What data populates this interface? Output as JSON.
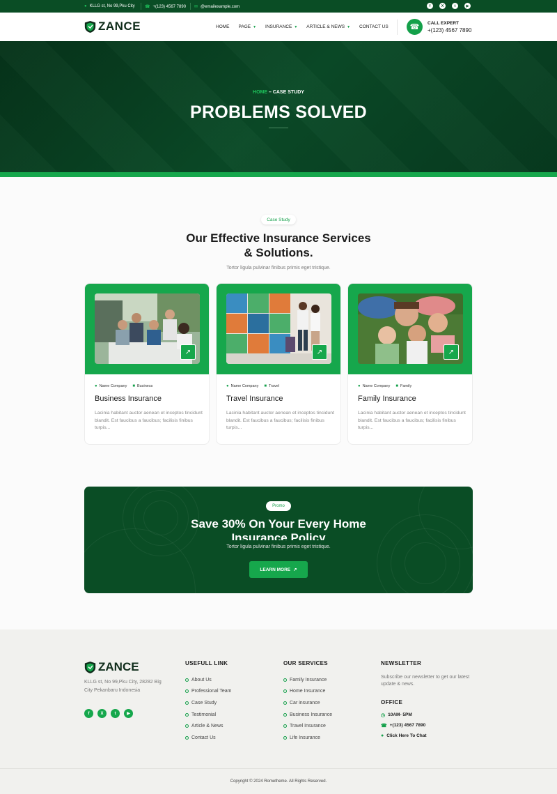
{
  "topbar": {
    "address": "KLLG st, No 99,Pku City",
    "phone": "+(123) 4567 7890",
    "email": "@emailexample.com",
    "social_icons": [
      "facebook-icon",
      "x-icon",
      "twitter-icon",
      "youtube-icon"
    ]
  },
  "nav": {
    "logo": "ZANCE",
    "items": [
      {
        "label": "HOME",
        "dropdown": false
      },
      {
        "label": "PAGE",
        "dropdown": true
      },
      {
        "label": "INSURANCE",
        "dropdown": true
      },
      {
        "label": "ARTICLE & NEWS",
        "dropdown": true
      },
      {
        "label": "CONTACT US",
        "dropdown": false
      }
    ],
    "call_label": "CALL EXPERT",
    "call_number": "+(123) 4567 7890"
  },
  "hero": {
    "crumb_home": "HOME",
    "crumb_current": "– CASE STUDY",
    "title": "PROBLEMS SOLVED"
  },
  "section": {
    "pill": "Case Study",
    "title_line1": "Our Effective Insurance Services",
    "title_line2": "& Solutions.",
    "subtitle": "Tortor ligula pulvinar finibus primis eget tristique."
  },
  "cards": [
    {
      "author": "Name Company",
      "category": "Business",
      "title": "Business Insurance",
      "text": "Lacinia habitant auctor aenean et inceptos tincidunt blandit. Est faucibus a faucibus; facilisis finibus turpis..."
    },
    {
      "author": "Name Company",
      "category": "Travel",
      "title": "Travel Insurance",
      "text": "Lacinia habitant auctor aenean et inceptos tincidunt blandit. Est faucibus a faucibus; facilisis finibus turpis..."
    },
    {
      "author": "Name Company",
      "category": "Family",
      "title": "Family Insurance",
      "text": "Lacinia habitant auctor aenean et inceptos tincidunt blandit. Est faucibus a faucibus; facilisis finibus turpis..."
    }
  ],
  "promo": {
    "pill": "Promo",
    "title_line1": "Save 30% On Your Every Home",
    "title_line2": "Insurance Policy",
    "subtitle": "Tortor ligula pulvinar finibus primis eget tristique.",
    "button": "LEARN MORE"
  },
  "footer": {
    "logo": "ZANCE",
    "address": "KLLG st, No 99,Pku City, 28282 Big City Pekanbaru Indonesia",
    "social_icons": [
      "facebook-icon",
      "x-icon",
      "twitter-icon",
      "youtube-icon"
    ],
    "useful_title": "USEFULL LINK",
    "useful_links": [
      "About Us",
      "Professional Team",
      "Case Study",
      "Testimonial",
      "Article & News",
      "Contact Us"
    ],
    "services_title": "OUR SERVICES",
    "services": [
      "Family Insurance",
      "Home Insurance",
      "Car insurance",
      "Business Insurance",
      "Travel Insurance",
      "Life Insurance"
    ],
    "newsletter_title": "NEWSLETTER",
    "newsletter_text": "Subscribe our newsletter to get our latest update & news.",
    "office_title": "OFFICE",
    "hours": "10AM- 5PM",
    "phone": "+(123) 4567 7890",
    "chat": "Click Here To Chat",
    "copyright": "Copyright © 2024 Rometheme. All Rights Reserved."
  },
  "colors": {
    "brand_dark": "#0a4d25",
    "brand_green": "#16a74c"
  }
}
